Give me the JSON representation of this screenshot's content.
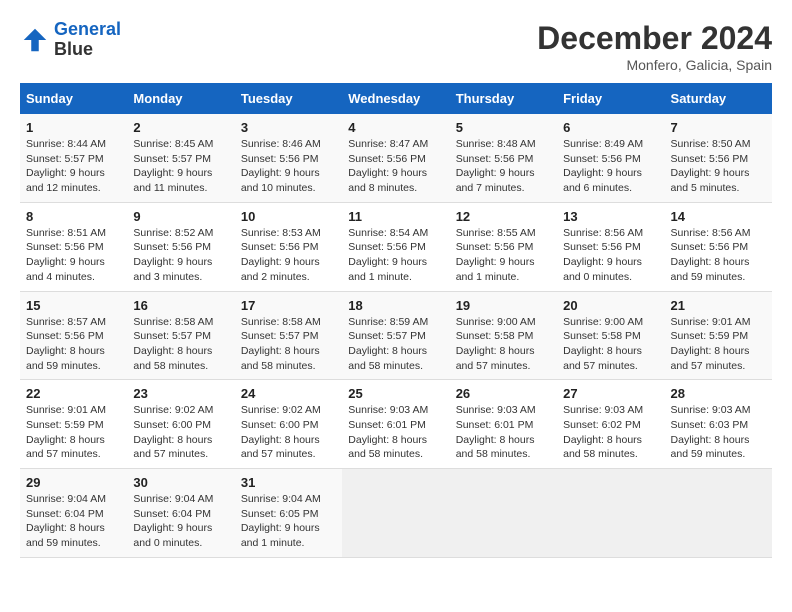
{
  "header": {
    "logo_line1": "General",
    "logo_line2": "Blue",
    "month_title": "December 2024",
    "location": "Monfero, Galicia, Spain"
  },
  "weekdays": [
    "Sunday",
    "Monday",
    "Tuesday",
    "Wednesday",
    "Thursday",
    "Friday",
    "Saturday"
  ],
  "weeks": [
    [
      {
        "day": "1",
        "sunrise": "8:44 AM",
        "sunset": "5:57 PM",
        "daylight": "9 hours and 12 minutes."
      },
      {
        "day": "2",
        "sunrise": "8:45 AM",
        "sunset": "5:57 PM",
        "daylight": "9 hours and 11 minutes."
      },
      {
        "day": "3",
        "sunrise": "8:46 AM",
        "sunset": "5:56 PM",
        "daylight": "9 hours and 10 minutes."
      },
      {
        "day": "4",
        "sunrise": "8:47 AM",
        "sunset": "5:56 PM",
        "daylight": "9 hours and 8 minutes."
      },
      {
        "day": "5",
        "sunrise": "8:48 AM",
        "sunset": "5:56 PM",
        "daylight": "9 hours and 7 minutes."
      },
      {
        "day": "6",
        "sunrise": "8:49 AM",
        "sunset": "5:56 PM",
        "daylight": "9 hours and 6 minutes."
      },
      {
        "day": "7",
        "sunrise": "8:50 AM",
        "sunset": "5:56 PM",
        "daylight": "9 hours and 5 minutes."
      }
    ],
    [
      {
        "day": "8",
        "sunrise": "8:51 AM",
        "sunset": "5:56 PM",
        "daylight": "9 hours and 4 minutes."
      },
      {
        "day": "9",
        "sunrise": "8:52 AM",
        "sunset": "5:56 PM",
        "daylight": "9 hours and 3 minutes."
      },
      {
        "day": "10",
        "sunrise": "8:53 AM",
        "sunset": "5:56 PM",
        "daylight": "9 hours and 2 minutes."
      },
      {
        "day": "11",
        "sunrise": "8:54 AM",
        "sunset": "5:56 PM",
        "daylight": "9 hours and 1 minute."
      },
      {
        "day": "12",
        "sunrise": "8:55 AM",
        "sunset": "5:56 PM",
        "daylight": "9 hours and 1 minute."
      },
      {
        "day": "13",
        "sunrise": "8:56 AM",
        "sunset": "5:56 PM",
        "daylight": "9 hours and 0 minutes."
      },
      {
        "day": "14",
        "sunrise": "8:56 AM",
        "sunset": "5:56 PM",
        "daylight": "8 hours and 59 minutes."
      }
    ],
    [
      {
        "day": "15",
        "sunrise": "8:57 AM",
        "sunset": "5:56 PM",
        "daylight": "8 hours and 59 minutes."
      },
      {
        "day": "16",
        "sunrise": "8:58 AM",
        "sunset": "5:57 PM",
        "daylight": "8 hours and 58 minutes."
      },
      {
        "day": "17",
        "sunrise": "8:58 AM",
        "sunset": "5:57 PM",
        "daylight": "8 hours and 58 minutes."
      },
      {
        "day": "18",
        "sunrise": "8:59 AM",
        "sunset": "5:57 PM",
        "daylight": "8 hours and 58 minutes."
      },
      {
        "day": "19",
        "sunrise": "9:00 AM",
        "sunset": "5:58 PM",
        "daylight": "8 hours and 57 minutes."
      },
      {
        "day": "20",
        "sunrise": "9:00 AM",
        "sunset": "5:58 PM",
        "daylight": "8 hours and 57 minutes."
      },
      {
        "day": "21",
        "sunrise": "9:01 AM",
        "sunset": "5:59 PM",
        "daylight": "8 hours and 57 minutes."
      }
    ],
    [
      {
        "day": "22",
        "sunrise": "9:01 AM",
        "sunset": "5:59 PM",
        "daylight": "8 hours and 57 minutes."
      },
      {
        "day": "23",
        "sunrise": "9:02 AM",
        "sunset": "6:00 PM",
        "daylight": "8 hours and 57 minutes."
      },
      {
        "day": "24",
        "sunrise": "9:02 AM",
        "sunset": "6:00 PM",
        "daylight": "8 hours and 57 minutes."
      },
      {
        "day": "25",
        "sunrise": "9:03 AM",
        "sunset": "6:01 PM",
        "daylight": "8 hours and 58 minutes."
      },
      {
        "day": "26",
        "sunrise": "9:03 AM",
        "sunset": "6:01 PM",
        "daylight": "8 hours and 58 minutes."
      },
      {
        "day": "27",
        "sunrise": "9:03 AM",
        "sunset": "6:02 PM",
        "daylight": "8 hours and 58 minutes."
      },
      {
        "day": "28",
        "sunrise": "9:03 AM",
        "sunset": "6:03 PM",
        "daylight": "8 hours and 59 minutes."
      }
    ],
    [
      {
        "day": "29",
        "sunrise": "9:04 AM",
        "sunset": "6:04 PM",
        "daylight": "8 hours and 59 minutes."
      },
      {
        "day": "30",
        "sunrise": "9:04 AM",
        "sunset": "6:04 PM",
        "daylight": "9 hours and 0 minutes."
      },
      {
        "day": "31",
        "sunrise": "9:04 AM",
        "sunset": "6:05 PM",
        "daylight": "9 hours and 1 minute."
      },
      null,
      null,
      null,
      null
    ]
  ]
}
